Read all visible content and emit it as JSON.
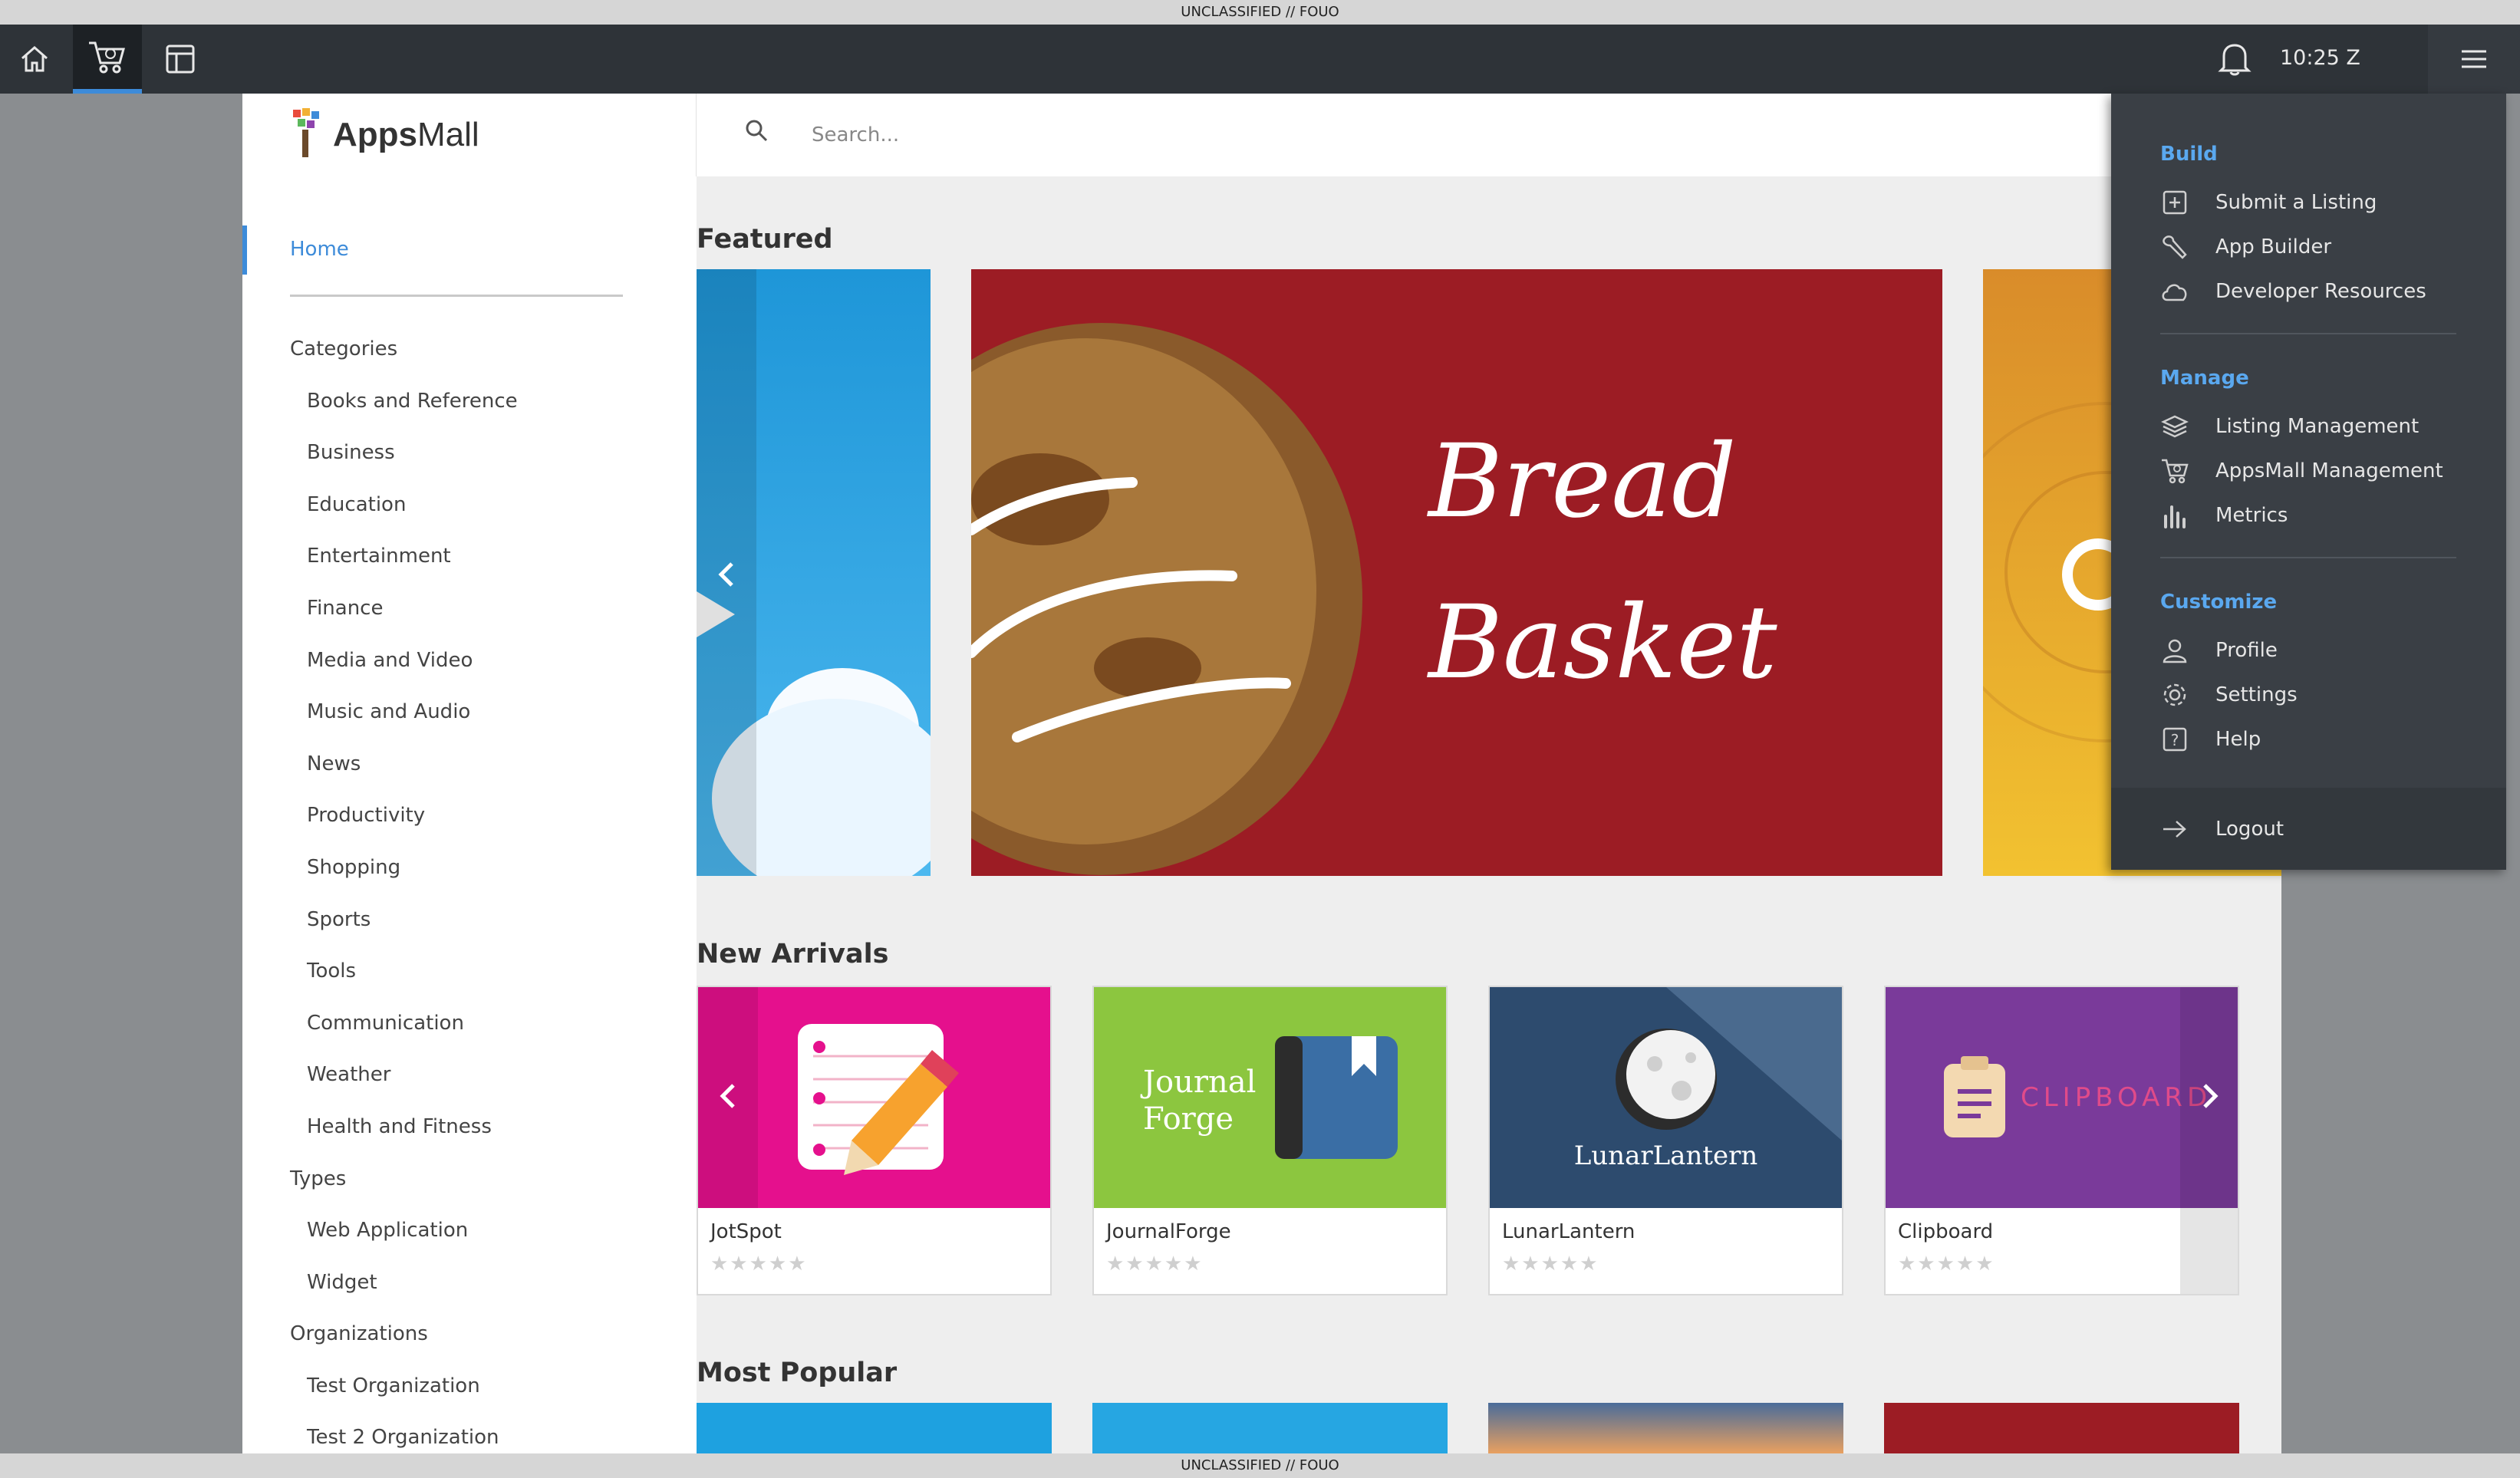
{
  "classification_banner": "UNCLASSIFIED // FOUO",
  "topbar": {
    "clock": "10:25 Z"
  },
  "logo": {
    "bold": "Apps",
    "rest": "Mall"
  },
  "search": {
    "placeholder": "Search..."
  },
  "sidebar": {
    "home": "Home",
    "items": [
      {
        "label": "Categories",
        "sub": false
      },
      {
        "label": "Books and Reference",
        "sub": true
      },
      {
        "label": "Business",
        "sub": true
      },
      {
        "label": "Education",
        "sub": true
      },
      {
        "label": "Entertainment",
        "sub": true
      },
      {
        "label": "Finance",
        "sub": true
      },
      {
        "label": "Media and Video",
        "sub": true
      },
      {
        "label": "Music and Audio",
        "sub": true
      },
      {
        "label": "News",
        "sub": true
      },
      {
        "label": "Productivity",
        "sub": true
      },
      {
        "label": "Shopping",
        "sub": true
      },
      {
        "label": "Sports",
        "sub": true
      },
      {
        "label": "Tools",
        "sub": true
      },
      {
        "label": "Communication",
        "sub": true
      },
      {
        "label": "Weather",
        "sub": true
      },
      {
        "label": "Health and Fitness",
        "sub": true
      },
      {
        "label": "Types",
        "sub": false
      },
      {
        "label": "Web Application",
        "sub": true
      },
      {
        "label": "Widget",
        "sub": true
      },
      {
        "label": "Organizations",
        "sub": false
      },
      {
        "label": "Test Organization",
        "sub": true
      },
      {
        "label": "Test 2 Organization",
        "sub": true
      }
    ]
  },
  "main": {
    "featured_title": "Featured",
    "featured_banner": {
      "line1": "Bread",
      "line2": "Basket"
    },
    "arrivals_title": "New Arrivals",
    "popular_title": "Most Popular",
    "arrivals": [
      {
        "name": "JotSpot",
        "rating": 0,
        "art_label": ""
      },
      {
        "name": "JournalForge",
        "rating": 0,
        "art_label": "Journal Forge"
      },
      {
        "name": "LunarLantern",
        "rating": 0,
        "art_label": "LunarLantern"
      },
      {
        "name": "Clipboard",
        "rating": 0,
        "art_label": "CLIPBOARD"
      }
    ]
  },
  "menu": {
    "build": "Build",
    "submit_listing": "Submit a Listing",
    "app_builder": "App Builder",
    "developer_resources": "Developer Resources",
    "manage": "Manage",
    "listing_management": "Listing Management",
    "appsmall_management": "AppsMall Management",
    "metrics": "Metrics",
    "customize": "Customize",
    "profile": "Profile",
    "settings": "Settings",
    "help": "Help",
    "logout": "Logout"
  },
  "colors": {
    "accent": "#3d8bd9",
    "topbar": "#2e3338",
    "menu_bg": "#3a3f45"
  }
}
